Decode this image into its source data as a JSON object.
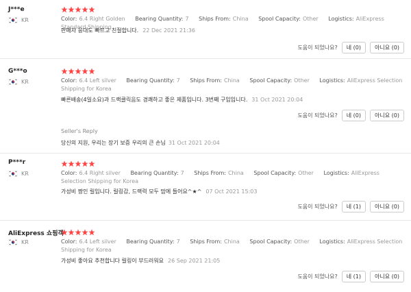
{
  "colors": {
    "star": "#ff4747",
    "flag_red": "#cd2e3a",
    "flag_blue": "#0047a0",
    "meta_gray": "#999999",
    "border": "#e8e8e8"
  },
  "helpful_label": "도움이 되었나요?",
  "reviews": [
    {
      "user": "J***e",
      "country": "KR",
      "rating": 5,
      "color_label": "Color:",
      "color_value": "6.4 Right Golden",
      "bearing_label": "Bearing Quantity:",
      "bearing_value": "7",
      "ships_label": "Ships From:",
      "ships_value": "China",
      "spool_label": "Spool Capacity:",
      "spool_value": "Other",
      "logistics_label": "Logistics:",
      "logistics_value": "AliExpress Standard Shipping",
      "text": "판매자 응대도 빠르고 친절합니다.",
      "date": "22 Dec 2021 21:36",
      "yes_label": "네 (0)",
      "no_label": "아니요 (0)"
    },
    {
      "user": "G***o",
      "country": "KR",
      "rating": 5,
      "color_label": "Color:",
      "color_value": "6.4 Left silver",
      "bearing_label": "Bearing Quantity:",
      "bearing_value": "7",
      "ships_label": "Ships From:",
      "ships_value": "China",
      "spool_label": "Spool Capacity:",
      "spool_value": "Other",
      "logistics_label": "Logistics:",
      "logistics_value": "AliExpress Selection Shipping for Korea",
      "text": "빠른배송(4일소요)과 드랙클릭음도 경쾌하고 좋은 제품입니다. 3번째 구입입니다.",
      "date": "31 Oct 2021 20:04",
      "reply_label": "Seller's Reply",
      "reply_text": "당신의 지원, 우리는 장기 보증 우리의 큰 손님",
      "reply_date": "31 Oct 2021 20:04",
      "yes_label": "네 (0)",
      "no_label": "아니요 (0)"
    },
    {
      "user": "P***r",
      "country": "KR",
      "rating": 5,
      "color_label": "Color:",
      "color_value": "6.4 Right silver",
      "bearing_label": "Bearing Quantity:",
      "bearing_value": "7",
      "ships_label": "Ships From:",
      "ships_value": "China",
      "spool_label": "Spool Capacity:",
      "spool_value": "Other",
      "logistics_label": "Logistics:",
      "logistics_value": "AliExpress Selection Shipping for Korea",
      "text": "가성비 짱인 릴입니다. 릴링감, 드랙력 모두 맘에 들어요^★^",
      "date": "07 Oct 2021 15:03",
      "yes_label": "네 (1)",
      "no_label": "아니요 (0)"
    },
    {
      "user": "AliExpress 쇼핑객",
      "country": "KR",
      "rating": 5,
      "color_label": "Color:",
      "color_value": "6.4 Left silver",
      "bearing_label": "Bearing Quantity:",
      "bearing_value": "7",
      "ships_label": "Ships From:",
      "ships_value": "China",
      "spool_label": "Spool Capacity:",
      "spool_value": "Other",
      "logistics_label": "Logistics:",
      "logistics_value": "AliExpress Selection Shipping for Korea",
      "text": "가성비 좋아요 추천합니다 릴링이 부드러워요",
      "date": "26 Sep 2021 21:05",
      "yes_label": "네 (1)",
      "no_label": "아니요 (0)"
    }
  ]
}
